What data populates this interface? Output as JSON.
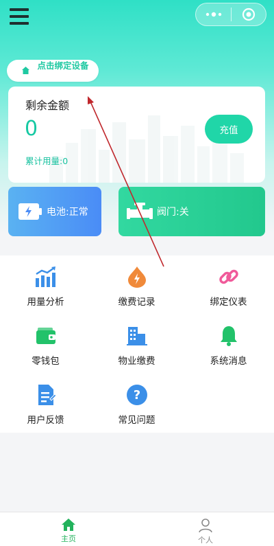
{
  "header": {
    "bind_device_label": "点击绑定设备"
  },
  "balance": {
    "title": "剩余金额",
    "value": "0",
    "usage_label": "累计用量:0",
    "recharge_label": "充值"
  },
  "status": {
    "battery_label": "电池:正常",
    "valve_label": "阀门:关"
  },
  "menu": {
    "items": [
      {
        "label": "用量分析",
        "icon": "bar-chart-icon"
      },
      {
        "label": "缴费记录",
        "icon": "payment-record-icon"
      },
      {
        "label": "绑定仪表",
        "icon": "link-icon"
      },
      {
        "label": "零钱包",
        "icon": "wallet-icon"
      },
      {
        "label": "物业缴费",
        "icon": "building-icon"
      },
      {
        "label": "系统消息",
        "icon": "bell-icon"
      },
      {
        "label": "用户反馈",
        "icon": "feedback-icon"
      },
      {
        "label": "常见问题",
        "icon": "question-icon"
      }
    ]
  },
  "tabbar": {
    "tabs": [
      {
        "label": "主页",
        "icon": "home-icon",
        "active": true
      },
      {
        "label": "个人",
        "icon": "user-icon",
        "active": false
      }
    ]
  },
  "colors": {
    "accent": "#1fc9a2",
    "battery_card": "#4a8cf6",
    "valve_card": "#22c88d",
    "tab_active": "#22b25c"
  }
}
